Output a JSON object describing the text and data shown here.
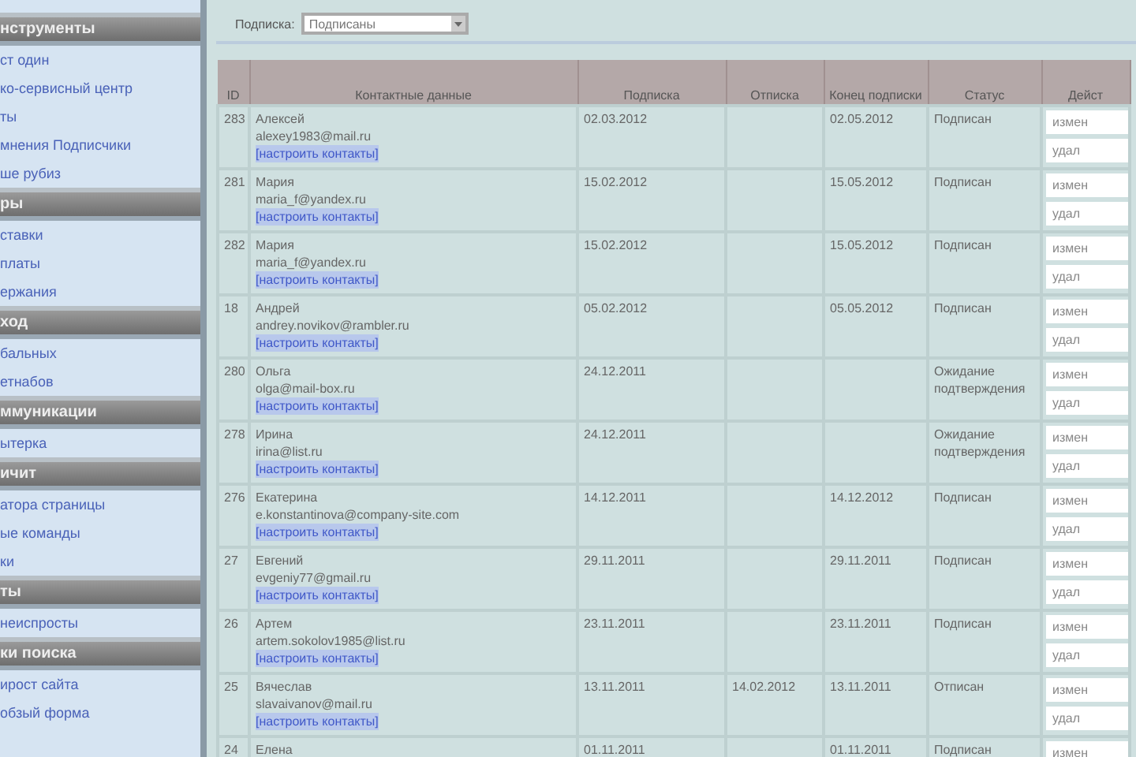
{
  "sidebar": {
    "sections": [
      {
        "title": "нструменты",
        "items": [
          "ст один",
          "ко-сервисный центр",
          "ты",
          "мнения Подписчики",
          "ше рубиз"
        ]
      },
      {
        "title": "ры",
        "items": [
          "ставки",
          "платы",
          "ержания"
        ]
      },
      {
        "title": "ход",
        "items": [
          "бальных",
          "етнабов"
        ]
      },
      {
        "title": "ммуникации",
        "items": [
          "ытерка"
        ]
      },
      {
        "title": "ичит",
        "items": [
          "атора страницы",
          "ые команды",
          "ки"
        ]
      },
      {
        "title": "ты",
        "items": [
          "неиспросты"
        ]
      },
      {
        "title": "ки поиска",
        "items": [
          "ирост сайта",
          "обзый форма"
        ]
      }
    ]
  },
  "filter": {
    "label": "Подписка:",
    "value": "Подписаны"
  },
  "table": {
    "columns": [
      "ID",
      "Контактные данные",
      "Подписка",
      "Отписка",
      "Конец подписки",
      "Статус",
      "Дейст"
    ],
    "rows": [
      {
        "id": "283",
        "name": "Алексей",
        "email": "alexey1983@mail.ru",
        "link": "[настроить контакты]",
        "subscribed": "02.03.2012",
        "unsubscribed": "",
        "ends": "02.05.2012",
        "status": "Подписан",
        "actions": [
          "измен",
          "удал"
        ]
      },
      {
        "id": "281",
        "name": "Мария",
        "email": "maria_f@yandex.ru",
        "link": "[настроить контакты]",
        "subscribed": "15.02.2012",
        "unsubscribed": "",
        "ends": "15.05.2012",
        "status": "Подписан",
        "actions": [
          "измен",
          "удал"
        ]
      },
      {
        "id": "282",
        "name": "Мария",
        "email": "maria_f@yandex.ru",
        "link": "[настроить контакты]",
        "subscribed": "15.02.2012",
        "unsubscribed": "",
        "ends": "15.05.2012",
        "status": "Подписан",
        "actions": [
          "измен",
          "удал"
        ]
      },
      {
        "id": "18",
        "name": "Андрей",
        "email": "andrey.novikov@rambler.ru",
        "link": "[настроить контакты]",
        "subscribed": "05.02.2012",
        "unsubscribed": "",
        "ends": "05.05.2012",
        "status": "Подписан",
        "actions": [
          "измен",
          "удал"
        ]
      },
      {
        "id": "280",
        "name": "Ольга",
        "email": "olga@mail-box.ru",
        "link": "[настроить контакты]",
        "subscribed": "24.12.2011",
        "unsubscribed": "",
        "ends": "",
        "status": "Ожидание подтверждения",
        "actions": [
          "измен",
          "удал"
        ]
      },
      {
        "id": "278",
        "name": "Ирина",
        "email": "irina@list.ru",
        "link": "[настроить контакты]",
        "subscribed": "24.12.2011",
        "unsubscribed": "",
        "ends": "",
        "status": "Ожидание подтверждения",
        "actions": [
          "измен",
          "удал"
        ]
      },
      {
        "id": "276",
        "name": "Екатерина",
        "email": "e.konstantinova@company-site.com",
        "link": "[настроить контакты]",
        "subscribed": "14.12.2011",
        "unsubscribed": "",
        "ends": "14.12.2012",
        "status": "Подписан",
        "actions": [
          "измен",
          "удал"
        ]
      },
      {
        "id": "27",
        "name": "Евгений",
        "email": "evgeniy77@gmail.ru",
        "link": "[настроить контакты]",
        "subscribed": "29.11.2011",
        "unsubscribed": "",
        "ends": "29.11.2011",
        "status": "Подписан",
        "actions": [
          "измен",
          "удал"
        ]
      },
      {
        "id": "26",
        "name": "Артем",
        "email": "artem.sokolov1985@list.ru",
        "link": "[настроить контакты]",
        "subscribed": "23.11.2011",
        "unsubscribed": "",
        "ends": "23.11.2011",
        "status": "Подписан",
        "actions": [
          "измен",
          "удал"
        ]
      },
      {
        "id": "25",
        "name": "Вячеслав",
        "email": "slavaivanov@mail.ru",
        "link": "[настроить контакты]",
        "subscribed": "13.11.2011",
        "unsubscribed": "14.02.2012",
        "ends": "13.11.2011",
        "status": "Отписан",
        "actions": [
          "измен",
          "удал"
        ]
      },
      {
        "id": "24",
        "name": "Елена",
        "subscribed": "01.11.2011",
        "unsubscribed": "",
        "ends": "01.11.2011",
        "status": "Подписан",
        "actions": [
          "измен"
        ]
      }
    ]
  }
}
